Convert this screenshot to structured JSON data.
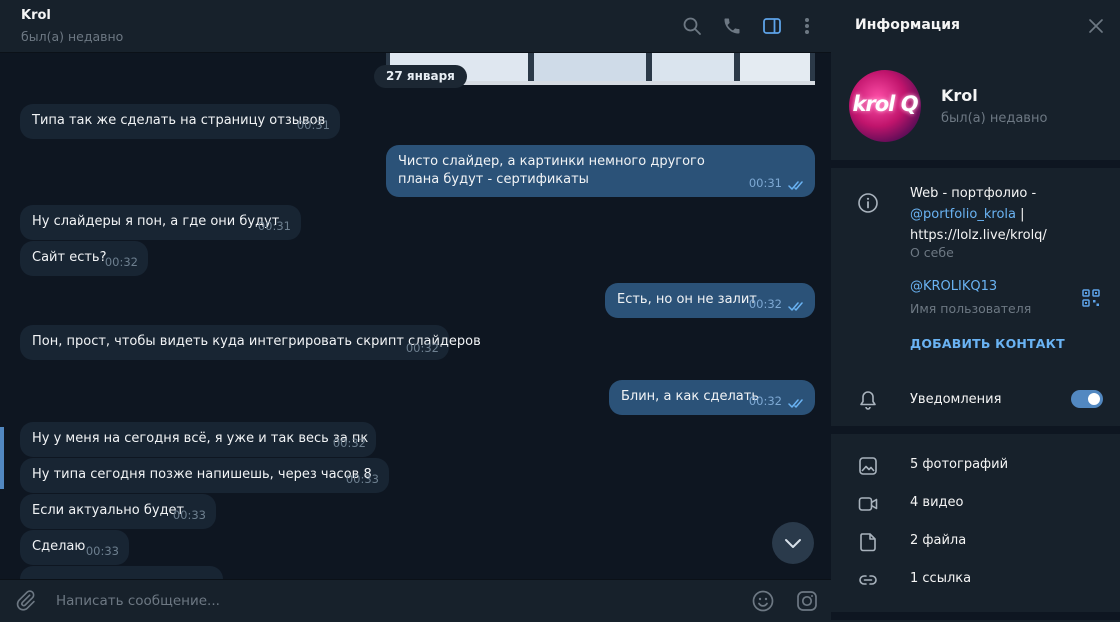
{
  "chat": {
    "peer_name": "Krol",
    "peer_status": "был(а) недавно",
    "date_pill": "27 января",
    "messages": [
      {
        "dir": "in",
        "text": "Типа так же сделать на страницу отзывов",
        "time": "00:31"
      },
      {
        "dir": "out",
        "text": "Чисто слайдер, а картинки немного другого плана будут - сертификаты",
        "time": "00:31"
      },
      {
        "dir": "in",
        "text": "Ну слайдеры я пон, а где они будут",
        "time": "00:31"
      },
      {
        "dir": "in",
        "text": "Сайт есть?",
        "time": "00:32"
      },
      {
        "dir": "out",
        "text": "Есть, но он не залит",
        "time": "00:32"
      },
      {
        "dir": "in",
        "text": "Пон, прост, чтобы видеть куда интегрировать скрипт слайдеров",
        "time": "00:32"
      },
      {
        "dir": "out",
        "text": "Блин, а как сделать",
        "time": "00:32"
      },
      {
        "dir": "in",
        "text": "Ну у меня на сегодня всё, я уже и так весь за пк",
        "time": "00:32"
      },
      {
        "dir": "in",
        "text": "Ну типа сегодня позже напишешь, через часов 8",
        "time": "00:33"
      },
      {
        "dir": "in",
        "text": "Если актуально будет",
        "time": "00:33"
      },
      {
        "dir": "in",
        "text": "Сделаю",
        "time": "00:33"
      }
    ],
    "composer_placeholder": "Написать сообщение..."
  },
  "icons": {
    "search": "search-icon",
    "call": "phone-icon",
    "sidebar": "sidebar-toggle-icon",
    "more": "more-vertical-icon",
    "attach": "paperclip-icon",
    "emoji": "emoji-icon",
    "sticker": "sticker-icon",
    "scroll_down": "chevron-down-icon"
  },
  "info": {
    "title": "Информация",
    "avatar_text": "krol Q",
    "name": "Krol",
    "status": "был(а) недавно",
    "bio_prefix": "Web - портфолио -",
    "bio_link": "@portfolio_krola",
    "bio_sep": " |",
    "bio_url": "https://lolz.live/krolq/",
    "bio_caption": "О себе",
    "username": "@KROLIKQ13",
    "username_caption": "Имя пользователя",
    "add_contact": "ДОБАВИТЬ КОНТАКТ",
    "notifications": "Уведомления",
    "notifications_on": true,
    "media": [
      {
        "label": "5 фотографий",
        "icon": "photo-icon"
      },
      {
        "label": "4 видео",
        "icon": "video-icon"
      },
      {
        "label": "2 файла",
        "icon": "file-icon"
      },
      {
        "label": "1 ссылка",
        "icon": "link-icon"
      }
    ]
  },
  "colors": {
    "chat_bg": "#0e1621",
    "panel_bg": "#17212b",
    "bubble_in": "#182533",
    "bubble_out": "#2b5278",
    "accent": "#6ab3f3",
    "muted": "#6d7883"
  }
}
